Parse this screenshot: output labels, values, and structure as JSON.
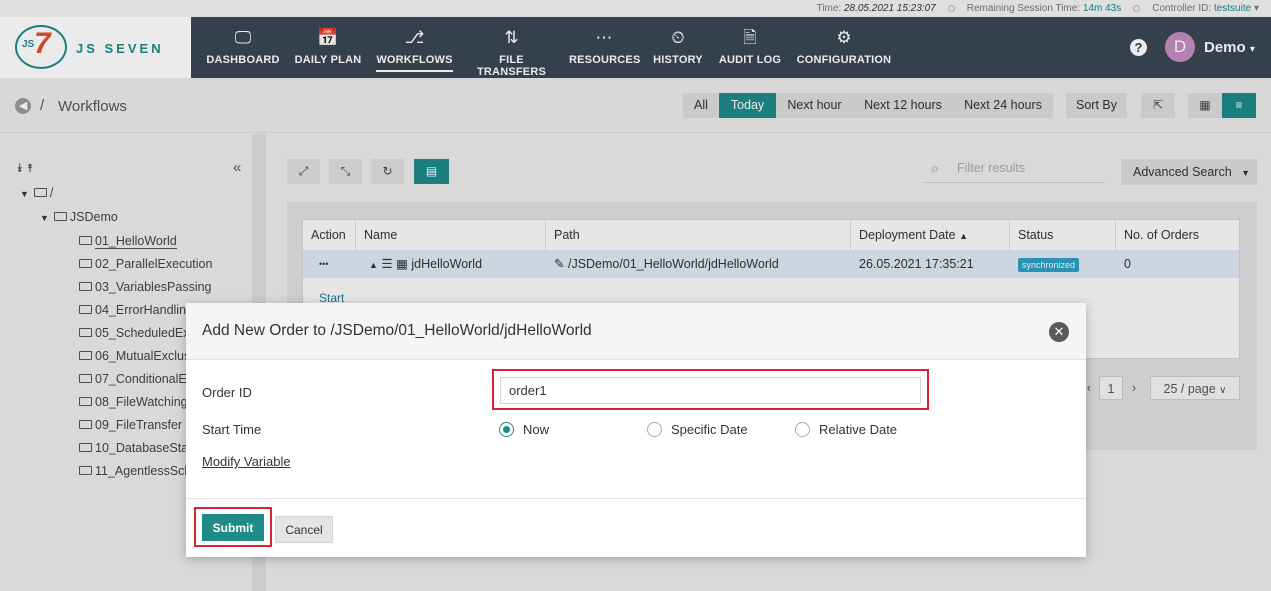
{
  "status_bar": {
    "time_label": "Time:",
    "time_value": "28.05.2021 15:23:07",
    "session_label": "Remaining Session Time:",
    "session_value": "14m 43s",
    "controller_label": "Controller ID:",
    "controller_value": "testsuite"
  },
  "brand": {
    "logo_js": "JS",
    "logo_seven": "7",
    "name": "JS SEVEN"
  },
  "nav": [
    {
      "label": "DASHBOARD",
      "icon": "monitor-icon",
      "glyph": "🖵"
    },
    {
      "label": "DAILY PLAN",
      "icon": "calendar-clock-icon",
      "glyph": "📅"
    },
    {
      "label": "WORKFLOWS",
      "icon": "workflow-icon",
      "glyph": "⎇"
    },
    {
      "label": "FILE TRANSFERS",
      "icon": "transfer-arrows-icon",
      "glyph": "⇅"
    },
    {
      "label": "RESOURCES",
      "icon": "share-icon",
      "glyph": "⋯"
    },
    {
      "label": "HISTORY",
      "icon": "history-clock-icon",
      "glyph": "⏲"
    },
    {
      "label": "AUDIT LOG",
      "icon": "audit-search-icon",
      "glyph": "🗎"
    },
    {
      "label": "CONFIGURATION",
      "icon": "gears-icon",
      "glyph": "⚙"
    }
  ],
  "user": {
    "initial": "D",
    "name": "Demo"
  },
  "breadcrumb": {
    "separator": "/",
    "title": "Workflows"
  },
  "date_filters": [
    "All",
    "Today",
    "Next hour",
    "Next 12 hours",
    "Next 24 hours"
  ],
  "sort_label": "Sort By",
  "tree": {
    "root": "/",
    "folder": "JSDemo",
    "items": [
      "01_HelloWorld",
      "02_ParallelExecution",
      "03_VariablesPassing",
      "04_ErrorHandlin",
      "05_ScheduledEx",
      "06_MutualExclus",
      "07_ConditionalE",
      "08_FileWatching",
      "09_FileTransfer",
      "10_DatabaseSta",
      "11_AgentlessSch"
    ]
  },
  "search": {
    "placeholder": "Filter results",
    "advanced_label": "Advanced Search"
  },
  "table": {
    "headers": [
      "Action",
      "Name",
      "Path",
      "Deployment Date",
      "Status",
      "No. of Orders"
    ],
    "row": {
      "action": "•••",
      "name": "jdHelloWorld",
      "path": "/JSDemo/01_HelloWorld/jdHelloWorld",
      "deployment_date": "26.05.2021 17:35:21",
      "status": "synchronized",
      "orders": "0"
    },
    "start_link": "Start"
  },
  "pagination": {
    "page": "1",
    "page_size": "25 / page"
  },
  "modal": {
    "title": "Add New Order to /JSDemo/01_HelloWorld/jdHelloWorld",
    "order_id_label": "Order ID",
    "order_id_value": "order1",
    "start_time_label": "Start Time",
    "start_options": [
      "Now",
      "Specific Date",
      "Relative Date"
    ],
    "modify_variable": "Modify Variable",
    "submit": "Submit",
    "cancel": "Cancel"
  },
  "colors": {
    "accent": "#1e8a8a",
    "navbar": "#3a4654",
    "highlight": "#d9262e",
    "status_badge": "#2d9fc5"
  }
}
